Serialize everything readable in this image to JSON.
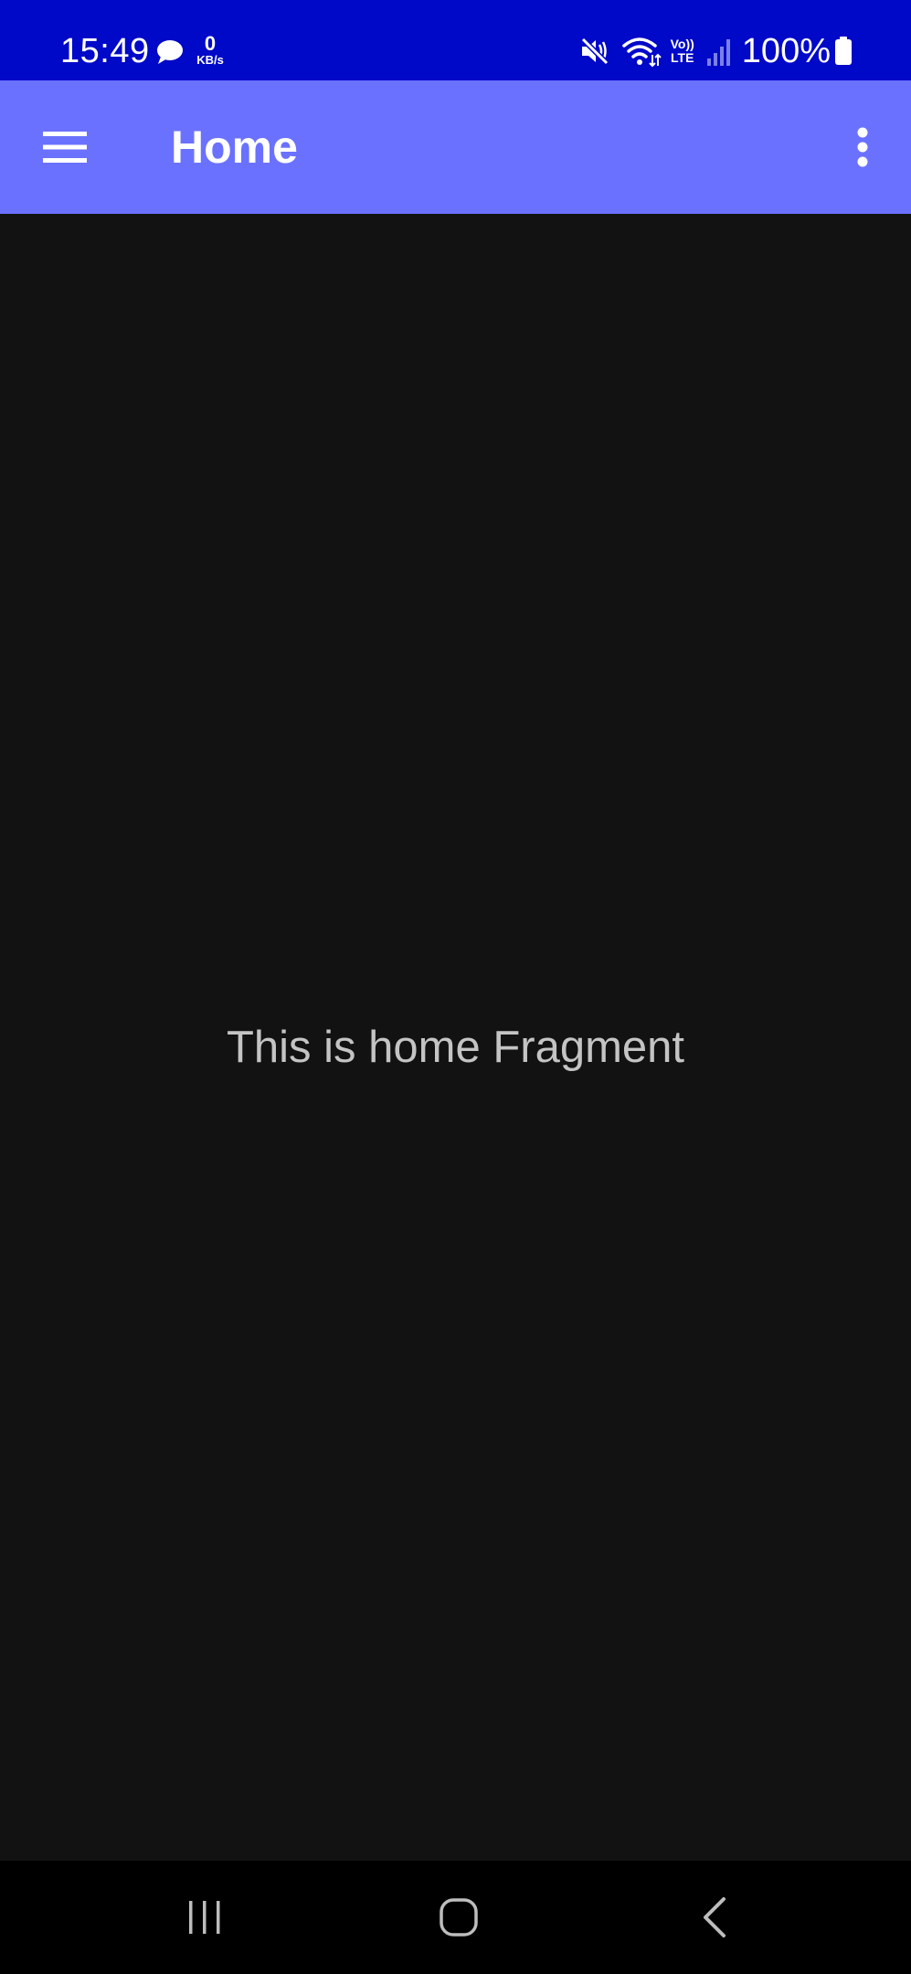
{
  "status_bar": {
    "time": "15:49",
    "net_speed_value": "0",
    "net_speed_unit": "KB/s",
    "volte_top": "Vo))",
    "volte_bottom": "LTE",
    "battery_text": "100%",
    "icons": [
      "chat-icon",
      "mute-icon",
      "wifi-icon",
      "volte-icon",
      "signal-icon",
      "battery-icon"
    ]
  },
  "app_bar": {
    "title": "Home",
    "menu_icon": "hamburger-menu-icon",
    "overflow_icon": "more-vert-icon"
  },
  "content": {
    "message": "This is home Fragment"
  },
  "nav_bar": {
    "icons": [
      "recents-icon",
      "home-icon",
      "back-icon"
    ]
  },
  "colors": {
    "status_bar_bg": "#0009c8",
    "app_bar_bg": "#6b71ff",
    "content_bg": "#121212",
    "nav_bar_bg": "#000000",
    "content_text": "#c4c4c4"
  }
}
